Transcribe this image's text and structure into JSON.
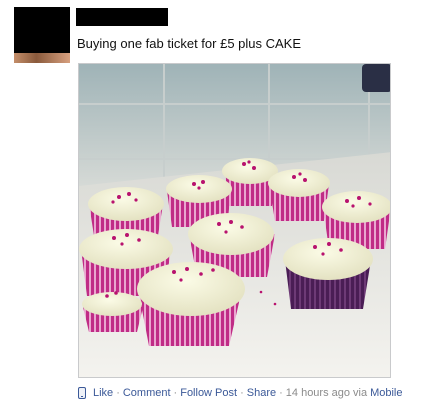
{
  "post": {
    "text": "Buying one fab ticket for £5 plus CAKE",
    "actions": {
      "like": "Like",
      "comment": "Comment",
      "follow": "Follow Post",
      "share": "Share"
    },
    "separator": "·",
    "timestamp": "14 hours ago",
    "via_prefix": "via",
    "via_source": "Mobile"
  },
  "icons": {
    "mobile": "mobile-phone-icon"
  },
  "colors": {
    "link": "#3b5998",
    "meta": "#8b8b8b"
  }
}
